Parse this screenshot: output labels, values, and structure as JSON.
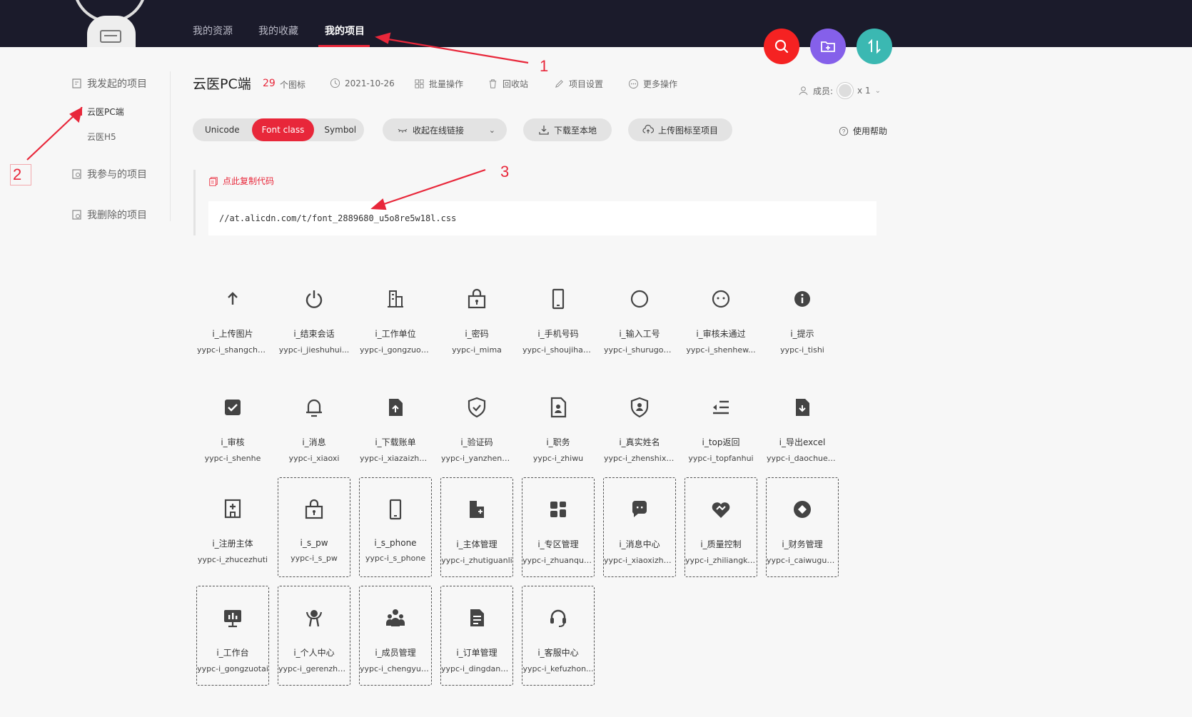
{
  "nav": {
    "items": [
      "我的资源",
      "我的收藏",
      "我的项目"
    ],
    "active_index": 2
  },
  "fabs": [
    {
      "name": "search-fab",
      "icon": "search-icon",
      "color": "#f52222"
    },
    {
      "name": "new-project-fab",
      "icon": "add-folder-icon",
      "color": "#8560ea"
    },
    {
      "name": "sort-fab",
      "icon": "sort-icon",
      "color": "#3bb8b2"
    }
  ],
  "sidebar": {
    "initiated": "我发起的项目",
    "projects": [
      "云医PC端",
      "云医H5"
    ],
    "participated": "我参与的项目",
    "deleted": "我删除的项目"
  },
  "project": {
    "title": "云医PC端",
    "icon_count": "29",
    "icon_count_label": "个图标",
    "date": "2021-10-26",
    "batch": "批量操作",
    "recycle": "回收站",
    "settings": "项目设置",
    "more": "更多操作",
    "members_label": "成员:",
    "members_count": "x 1"
  },
  "toolbar": {
    "segments": [
      "Unicode",
      "Font class",
      "Symbol"
    ],
    "active_segment": 1,
    "collapse_link": "收起在线链接",
    "download": "下载至本地",
    "upload": "上传图标至项目",
    "help": "使用帮助"
  },
  "code": {
    "copy_label": "点此复制代码",
    "url": "//at.alicdn.com/t/font_2889680_u5o8re5w18l.css"
  },
  "icons": [
    {
      "name": "i_上传图片",
      "code": "yypc-i_shangchu...",
      "glyph": "upload"
    },
    {
      "name": "i_结束会话",
      "code": "yypc-i_jieshuhui...",
      "glyph": "power"
    },
    {
      "name": "i_工作单位",
      "code": "yypc-i_gongzuod...",
      "glyph": "building"
    },
    {
      "name": "i_密码",
      "code": "yypc-i_mima",
      "glyph": "lockbox"
    },
    {
      "name": "i_手机号码",
      "code": "yypc-i_shoujihao...",
      "glyph": "phone"
    },
    {
      "name": "i_输入工号",
      "code": "yypc-i_shurugon...",
      "glyph": "circle"
    },
    {
      "name": "i_审核未通过",
      "code": "yypc-i_shenhew...",
      "glyph": "dotcircle"
    },
    {
      "name": "i_提示",
      "code": "yypc-i_tishi",
      "glyph": "info"
    },
    {
      "name": "i_审核",
      "code": "yypc-i_shenhe",
      "glyph": "checkbox"
    },
    {
      "name": "i_消息",
      "code": "yypc-i_xiaoxi",
      "glyph": "bell"
    },
    {
      "name": "i_下载账单",
      "code": "yypc-i_xiazaizha...",
      "glyph": "fileup"
    },
    {
      "name": "i_验证码",
      "code": "yypc-i_yanzheng...",
      "glyph": "shieldcheck"
    },
    {
      "name": "i_职务",
      "code": "yypc-i_zhiwu",
      "glyph": "badge"
    },
    {
      "name": "i_真实姓名",
      "code": "yypc-i_zhenshixi...",
      "glyph": "shielduser"
    },
    {
      "name": "i_top返回",
      "code": "yypc-i_topfanhui",
      "glyph": "indent"
    },
    {
      "name": "i_导出excel",
      "code": "yypc-i_daochuex...",
      "glyph": "filedown"
    },
    {
      "name": "i_注册主体",
      "code": "yypc-i_zhucezhuti",
      "glyph": "hospital",
      "dashed": false
    },
    {
      "name": "i_s_pw",
      "code": "yypc-i_s_pw",
      "glyph": "lockbox",
      "dashed": true
    },
    {
      "name": "i_s_phone",
      "code": "yypc-i_s_phone",
      "glyph": "phone",
      "dashed": true
    },
    {
      "name": "i_主体管理",
      "code": "yypc-i_zhutiguanli",
      "glyph": "buildingplus",
      "dashed": true
    },
    {
      "name": "i_专区管理",
      "code": "yypc-i_zhuanqug...",
      "glyph": "grid",
      "dashed": true
    },
    {
      "name": "i_消息中心",
      "code": "yypc-i_xiaoxizho...",
      "glyph": "chat",
      "dashed": true
    },
    {
      "name": "i_质量控制",
      "code": "yypc-i_zhiliangko...",
      "glyph": "heart",
      "dashed": true
    },
    {
      "name": "i_财务管理",
      "code": "yypc-i_caiwuguanli",
      "glyph": "diamond",
      "dashed": true
    },
    {
      "name": "i_工作台",
      "code": "yypc-i_gongzuotai",
      "glyph": "monitor",
      "dashed": true
    },
    {
      "name": "i_个人中心",
      "code": "yypc-i_gerenzho...",
      "glyph": "person",
      "dashed": true
    },
    {
      "name": "i_成员管理",
      "code": "yypc-i_chengyua...",
      "glyph": "group",
      "dashed": true
    },
    {
      "name": "i_订单管理",
      "code": "yypc-i_dingdang...",
      "glyph": "doc",
      "dashed": true
    },
    {
      "name": "i_客服中心",
      "code": "yypc-i_kefuzhon...",
      "glyph": "headset",
      "dashed": true
    }
  ],
  "annotations": [
    "1",
    "2",
    "3"
  ]
}
